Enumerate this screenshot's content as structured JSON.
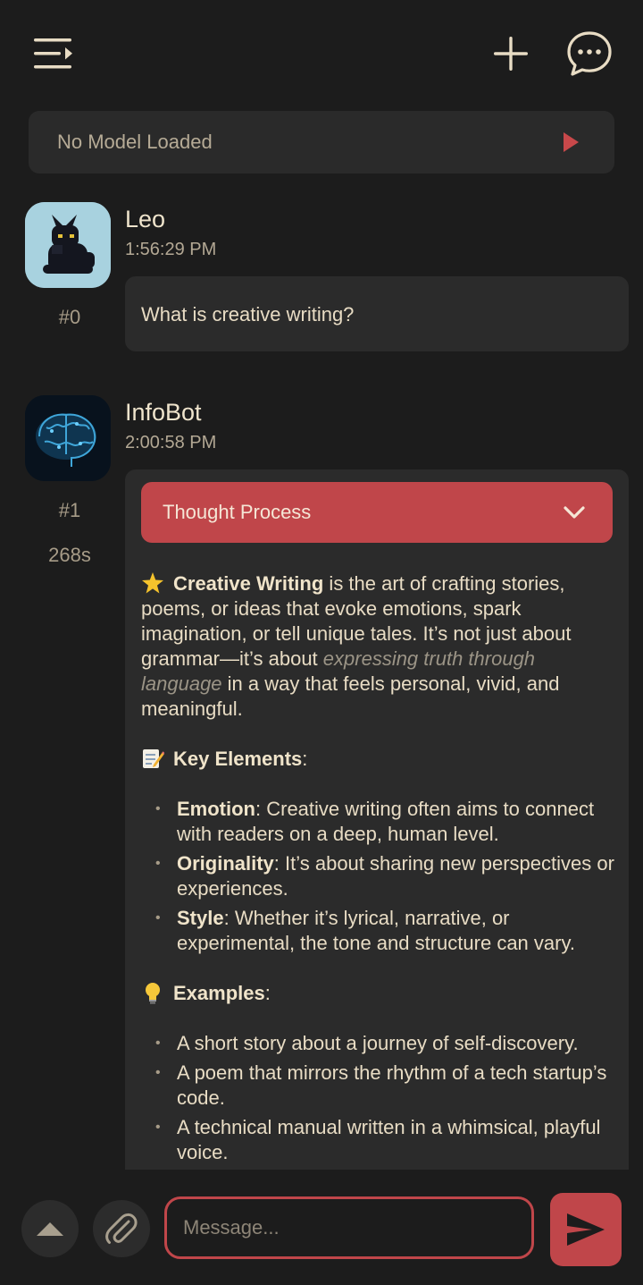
{
  "topbar": {
    "menu_icon": "menu-collapse-icon",
    "new_chat_icon": "plus-icon",
    "chats_icon": "chat-bubble-icon"
  },
  "model_bar": {
    "label": "No Model Loaded",
    "icon": "play-icon"
  },
  "messages": [
    {
      "sender": "Leo",
      "time": "1:56:29 PM",
      "index": "#0",
      "avatar": "black-cat-avatar",
      "text": "What is creative writing?"
    },
    {
      "sender": "InfoBot",
      "time": "2:00:58 PM",
      "index": "#1",
      "duration": "268s",
      "avatar": "brain-avatar",
      "thought_label": "Thought Process",
      "intro": {
        "emoji": "star-icon",
        "bold": "Creative Writing",
        "text1": " is the art of crafting stories, poems, or ideas that evoke emotions, spark imagination, or tell unique tales. It’s not just about grammar—it’s about ",
        "italic": "expressing truth through language",
        "text2": " in a way that feels personal, vivid, and meaningful."
      },
      "key_elements": {
        "emoji": "memo-icon",
        "heading": "Key Elements",
        "suffix": ":",
        "items": [
          {
            "term": "Emotion",
            "desc": ": Creative writing often aims to connect with readers on a deep, human level."
          },
          {
            "term": "Originality",
            "desc": ": It’s about sharing new perspectives or experiences."
          },
          {
            "term": "Style",
            "desc": ": Whether it’s lyrical, narrative, or experimental, the tone and structure can vary."
          }
        ]
      },
      "examples": {
        "emoji": "lightbulb-icon",
        "heading": "Examples",
        "suffix": ":",
        "items": [
          "A short story about a journey of self-discovery.",
          "A poem that mirrors the rhythm of a tech startup’s code.",
          "A technical manual written in a whimsical, playful voice."
        ]
      }
    }
  ],
  "bottombar": {
    "scroll_icon": "chevron-up-icon",
    "attach_icon": "paperclip-icon",
    "input_placeholder": "Message...",
    "input_value": "",
    "send_icon": "send-icon"
  },
  "colors": {
    "background": "#1c1c1c",
    "surface": "#2b2b2b",
    "accent": "#c0464a",
    "text": "#e8dcc4"
  }
}
